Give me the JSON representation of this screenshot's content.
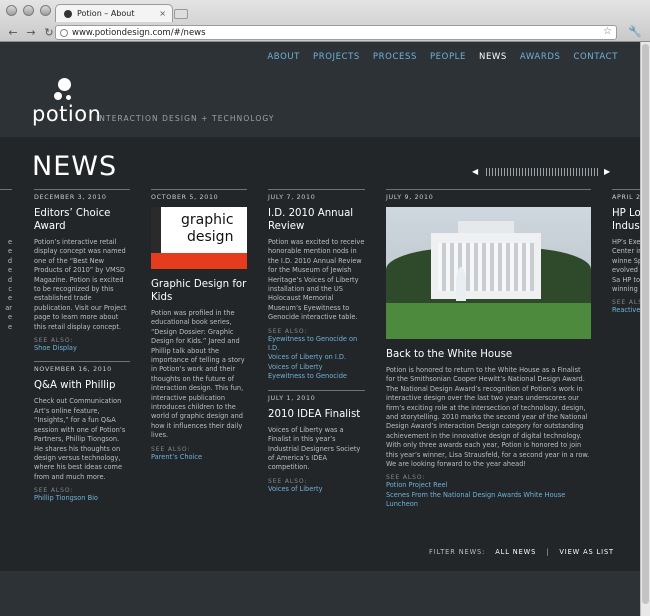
{
  "browser": {
    "tab_title": "Potion – About",
    "tab_close": "×",
    "url": "www.potiondesign.com/#/news",
    "back": "←",
    "forward": "→",
    "reload": "↻",
    "star": "☆",
    "wrench": "🔧"
  },
  "nav": {
    "items": [
      "ABOUT",
      "PROJECTS",
      "PROCESS",
      "PEOPLE",
      "NEWS",
      "AWARDS",
      "CONTACT"
    ],
    "active": "NEWS"
  },
  "logo": {
    "word": "potion"
  },
  "tagline": "INTERACTION DESIGN + TECHNOLOGY",
  "page_title": "NEWS",
  "pager": {
    "prev": "◀",
    "next": "▶"
  },
  "columns": [
    {
      "entries": [
        {
          "date": "DECEMBER 3, 2010",
          "headline": "Editors’ Choice Award",
          "body": "Potion’s interactive retail display concept was named one of the “Best New Products of 2010” by VMSD Magazine. Potion is excited to be recognized by this established trade publication. Visit our Project page to learn more about this retail display concept.",
          "see_also": "SEE ALSO:",
          "links": [
            "Shoe Display"
          ]
        },
        {
          "date": "NOVEMBER 16, 2010",
          "headline": "Q&A with Phillip",
          "body": "Check out Communication Art’s online feature, “Insights,” for a fun Q&A session with one of Potion’s Partners, Phillip Tiongson. He shares his thoughts on design versus technology, where his best ideas come from and much more.",
          "see_also": "SEE ALSO:",
          "links": [
            "Phillip Tiongson Bio"
          ]
        }
      ]
    },
    {
      "entries": [
        {
          "date": "OCTOBER 5, 2010",
          "image_text": [
            "graphic",
            "design"
          ],
          "headline": "Graphic Design for Kids",
          "body": "Potion was profiled in the educational book series, “Design Dossier: Graphic Design for Kids.” Jared and Phillip talk about the importance of telling a story in Potion’s work and their thoughts on the future of interaction design. This fun, interactive publication introduces children to the world of graphic design and how it influences their daily lives.",
          "see_also": "SEE ALSO:",
          "links": [
            "Parent’s Choice"
          ]
        }
      ]
    },
    {
      "entries": [
        {
          "date": "JULY 7, 2010",
          "headline": "I.D. 2010 Annual Review",
          "body": "Potion was excited to receive honorable mention nods in the I.D. 2010 Annual Review for the Museum of Jewish Heritage’s Voices of Liberty installation and the US Holocaust Memorial Museum’s Eyewitness to Genocide interactive table.",
          "see_also": "SEE ALSO:",
          "links": [
            "Eyewitness to Genocide on I.D.",
            "Voices of Liberty on I.D.",
            "Voices of Liberty",
            "Eyewitness to Genocide"
          ]
        },
        {
          "date": "JULY 1, 2010",
          "headline": "2010 IDEA Finalist",
          "body": "Voices of Liberty was a Finalist in this year’s Industrial Designers Society of America’s IDEA competition.",
          "see_also": "SEE ALSO:",
          "links": [
            "Voices of Liberty"
          ]
        }
      ]
    },
    {
      "entries": [
        {
          "date": "JULY 9, 2010",
          "headline": "Back to the White House",
          "body": "Potion is honored to return to the White House as a Finalist for the Smithsonian Cooper Hewitt’s National Design Award. The National Design Award’s recognition of Potion’s work in interactive design over the last two years underscores our firm’s exciting role at the intersection of technology, design, and storytelling. 2010 marks the second year of the National Design Award’s Interaction Design category for outstanding achievement in the innovative design of digital technology. With only three awards each year, Potion is honored to join this year’s winner, Lisa Strausfeld, for a second year in a row. We are looking forward to the year ahead!",
          "see_also": "SEE ALSO:",
          "links": [
            "Potion Project Reel",
            "Scenes From the National Design Awards White House Luncheon"
          ]
        }
      ]
    },
    {
      "entries": [
        {
          "date": "APRIL 2",
          "headline": "HP Lo Indust",
          "body": "HP’s Execu Center in the winne Space Aw evolved w Union, Sa HP to des winning s",
          "see_also": "SEE ALSO",
          "links": [
            "Reactive C"
          ]
        }
      ]
    }
  ],
  "left_edge_fragments": [
    "e",
    "e",
    "d",
    "e",
    "d",
    "c",
    "e",
    "ar",
    "e",
    "e"
  ],
  "filter": {
    "label": "FILTER NEWS:",
    "all": "ALL NEWS",
    "sep": "|",
    "list": "VIEW AS LIST"
  }
}
